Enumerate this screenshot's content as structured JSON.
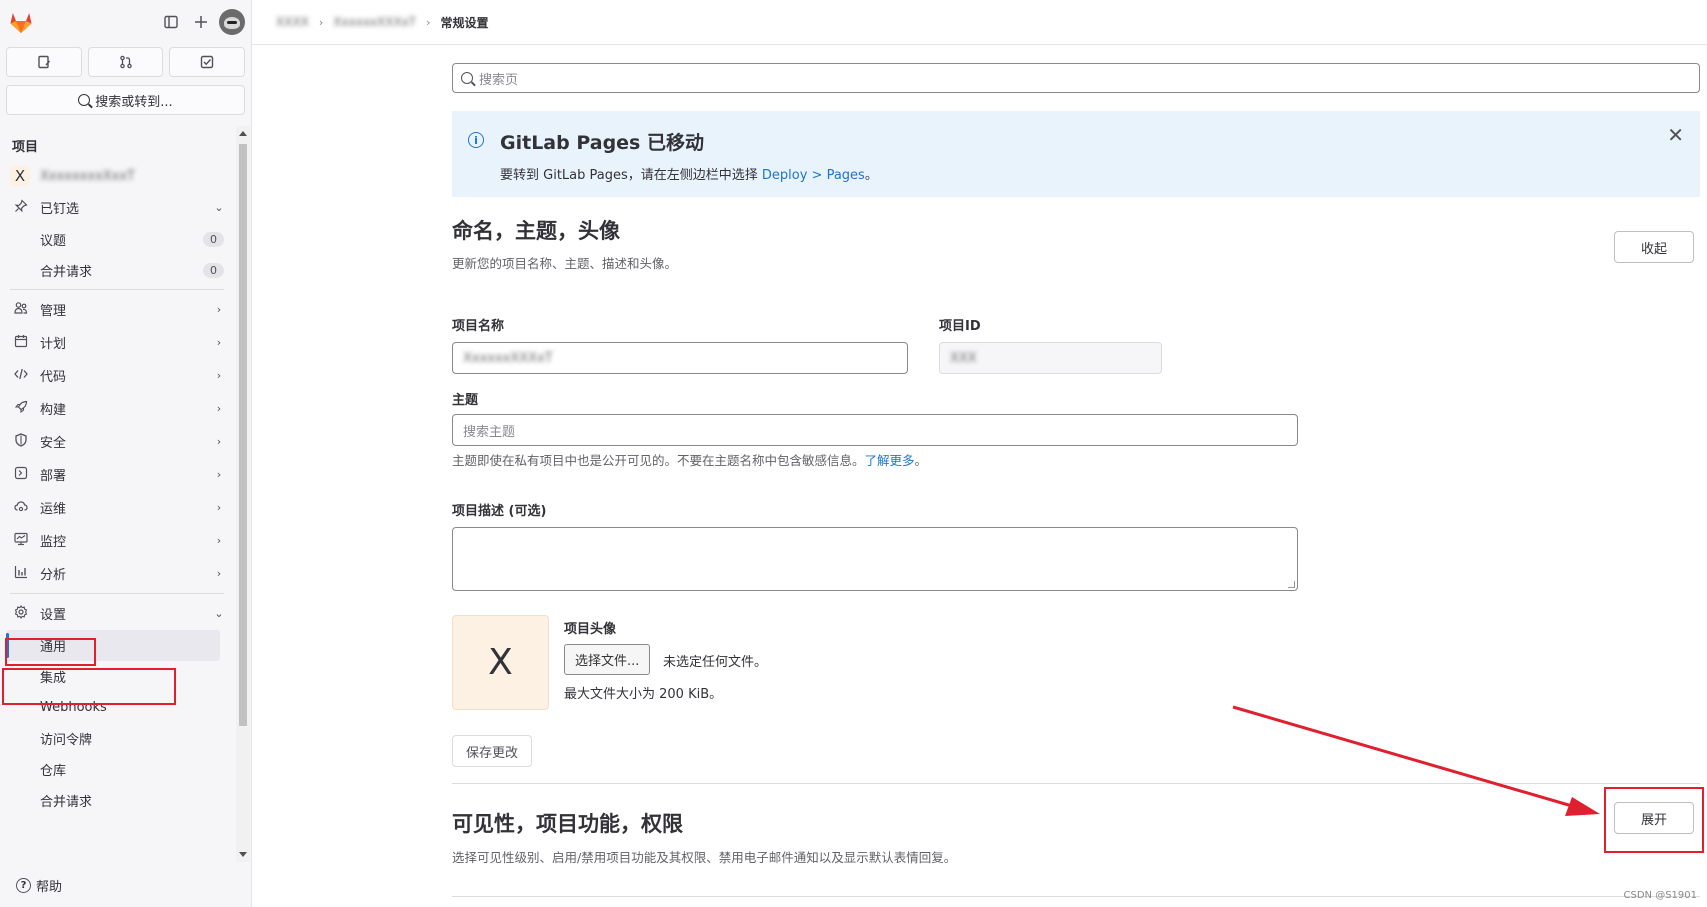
{
  "sidebar": {
    "search_label": "搜索或转到...",
    "section_label": "项目",
    "project_avatar": "X",
    "project_name": "XxxxxxxxXxxT",
    "pinned": {
      "label": "已钉选",
      "items": [
        {
          "label": "议题",
          "count": "0"
        },
        {
          "label": "合并请求",
          "count": "0"
        }
      ]
    },
    "nav": [
      {
        "label": "管理",
        "icon": "users-icon"
      },
      {
        "label": "计划",
        "icon": "calendar-icon"
      },
      {
        "label": "代码",
        "icon": "code-icon"
      },
      {
        "label": "构建",
        "icon": "rocket-icon"
      },
      {
        "label": "安全",
        "icon": "shield-icon"
      },
      {
        "label": "部署",
        "icon": "deploy-icon"
      },
      {
        "label": "运维",
        "icon": "cloud-icon"
      },
      {
        "label": "监控",
        "icon": "monitor-icon"
      },
      {
        "label": "分析",
        "icon": "chart-icon"
      }
    ],
    "settings": {
      "label": "设置",
      "items": [
        "通用",
        "集成",
        "Webhooks",
        "访问令牌",
        "仓库",
        "合并请求"
      ]
    },
    "help_label": "帮助"
  },
  "breadcrumb": {
    "items": [
      "XXXX",
      "XxxxxxXXXxT"
    ],
    "current": "常规设置"
  },
  "main": {
    "search_placeholder": "搜索页",
    "alert": {
      "title": "GitLab Pages 已移动",
      "body_prefix": "要转到 GitLab Pages，请在左侧边栏中选择 ",
      "body_link": "Deploy > Pages",
      "body_suffix": "。"
    },
    "naming": {
      "title": "命名，主题，头像",
      "description": "更新您的项目名称、主题、描述和头像。",
      "collapse_label": "收起",
      "name_label": "项目名称",
      "name_value": "XxxxxxXXXxT",
      "id_label": "项目ID",
      "id_value": "XXX",
      "topics_label": "主题",
      "topics_placeholder": "搜索主题",
      "topics_help": "主题即使在私有项目中也是公开可见的。不要在主题名称中包含敏感信息。",
      "topics_help_link": "了解更多",
      "topics_help_end": "。",
      "desc_label": "项目描述 (可选)",
      "avatar_letter": "X",
      "avatar_label": "项目头像",
      "choose_file_label": "选择文件...",
      "no_file_text": "未选定任何文件。",
      "max_size_text": "最大文件大小为 200 KiB。",
      "save_label": "保存更改"
    },
    "visibility": {
      "title": "可见性，项目功能，权限",
      "description": "选择可见性级别、启用/禁用项目功能及其权限、禁用电子邮件通知以及显示默认表情回复。",
      "expand_label": "展开"
    }
  },
  "watermark": "CSDN @S1901",
  "colors": {
    "accent": "#1f75cb",
    "annotation": "#e0202f",
    "alert_bg": "#e9f3fc"
  }
}
